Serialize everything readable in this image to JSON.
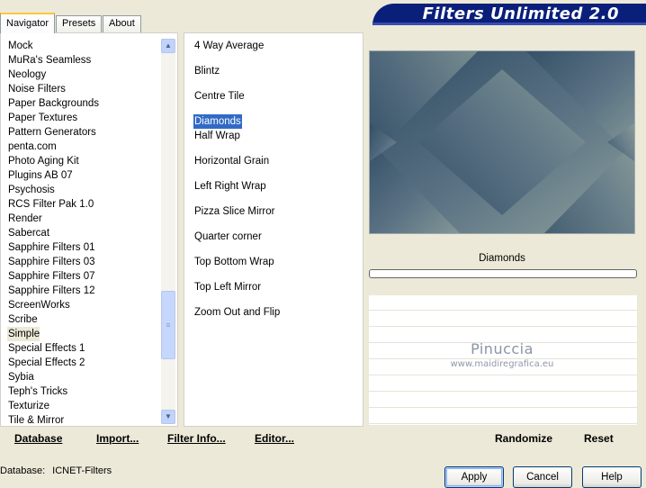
{
  "tabs": [
    "Navigator",
    "Presets",
    "About"
  ],
  "app_title": "Filters Unlimited 2.0",
  "categories": [
    "Mock",
    "MuRa's Seamless",
    "Neology",
    "Noise Filters",
    "Paper Backgrounds",
    "Paper Textures",
    "Pattern Generators",
    "penta.com",
    "Photo Aging Kit",
    "Plugins AB 07",
    "Psychosis",
    "RCS Filter Pak 1.0",
    "Render",
    "Sabercat",
    "Sapphire Filters 01",
    "Sapphire Filters 03",
    "Sapphire Filters 07",
    "Sapphire Filters 12",
    "ScreenWorks",
    "Scribe",
    "Simple",
    "Special Effects 1",
    "Special Effects 2",
    "Sybia",
    "Teph's Tricks",
    "Texturize",
    "Tile & Mirror"
  ],
  "current_category": "Simple",
  "filters": [
    "4 Way Average",
    "Blintz",
    "Centre Tile",
    "Diamonds",
    "Half Wrap",
    "Horizontal Grain",
    "Left Right Wrap",
    "Pizza Slice Mirror",
    "Quarter corner",
    "Top Bottom Wrap",
    "Top Left Mirror",
    "Zoom Out and Flip"
  ],
  "selected_filter": "Diamonds",
  "preview": {
    "filter_name": "Diamonds",
    "watermark_line1": "Pinuccia",
    "watermark_line2": "www.maidiregrafica.eu",
    "colors": {
      "dark": "#2e4a62",
      "mid": "#5b7384",
      "light": "#8fa19c"
    }
  },
  "bottom_buttons": {
    "database": "Database",
    "import": "Import...",
    "filter_info": "Filter Info...",
    "editor": "Editor...",
    "randomize": "Randomize",
    "reset": "Reset"
  },
  "status": {
    "database_label": "Database:",
    "database_value": "ICNET-Filters"
  },
  "dialog_buttons": {
    "apply": "Apply",
    "cancel": "Cancel",
    "help": "Help"
  }
}
